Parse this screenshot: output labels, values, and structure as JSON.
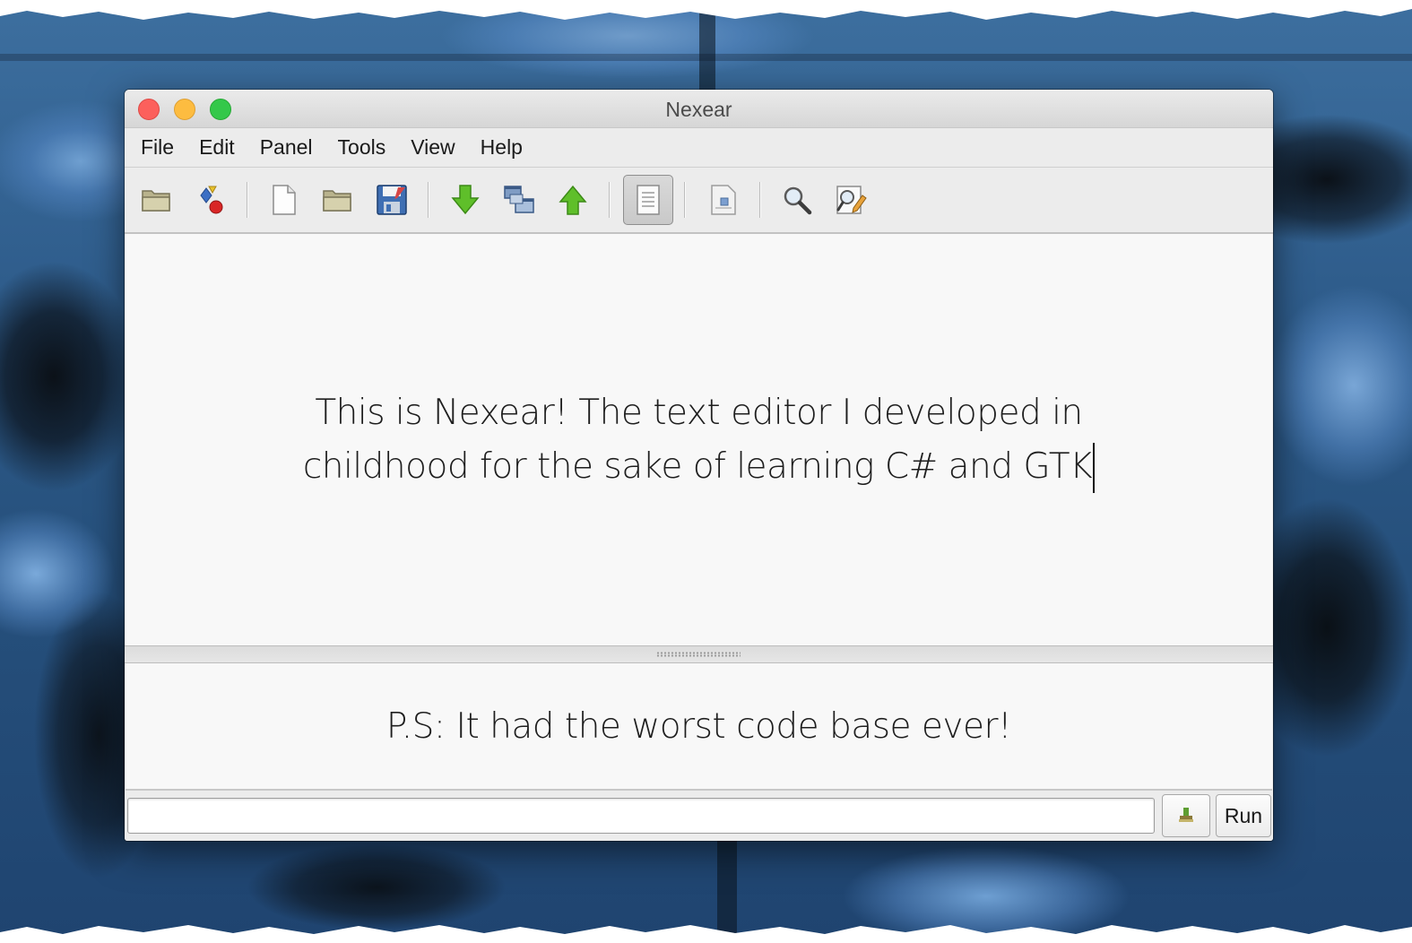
{
  "window": {
    "title": "Nexear"
  },
  "menu": {
    "items": [
      "File",
      "Edit",
      "Panel",
      "Tools",
      "View",
      "Help"
    ]
  },
  "toolbar": {
    "icons": [
      "folder-open-icon",
      "shapes-icon",
      "new-document-icon",
      "open-folder-icon",
      "save-icon",
      "download-arrow-icon",
      "windows-icon",
      "upload-arrow-icon",
      "document-view-icon",
      "page-icon",
      "search-icon",
      "edit-search-icon"
    ],
    "active": "document-view-icon"
  },
  "editor": {
    "line1": "This is Nexear! The text editor I developed in",
    "line2": "childhood for the sake of learning C# and GTK"
  },
  "panel": {
    "text": "P.S: It had the worst code base ever!"
  },
  "command": {
    "input_value": "",
    "run_label": "Run"
  },
  "colors": {
    "close": "#fc605c",
    "minimize": "#fdbc40",
    "maximize": "#34c84a"
  }
}
